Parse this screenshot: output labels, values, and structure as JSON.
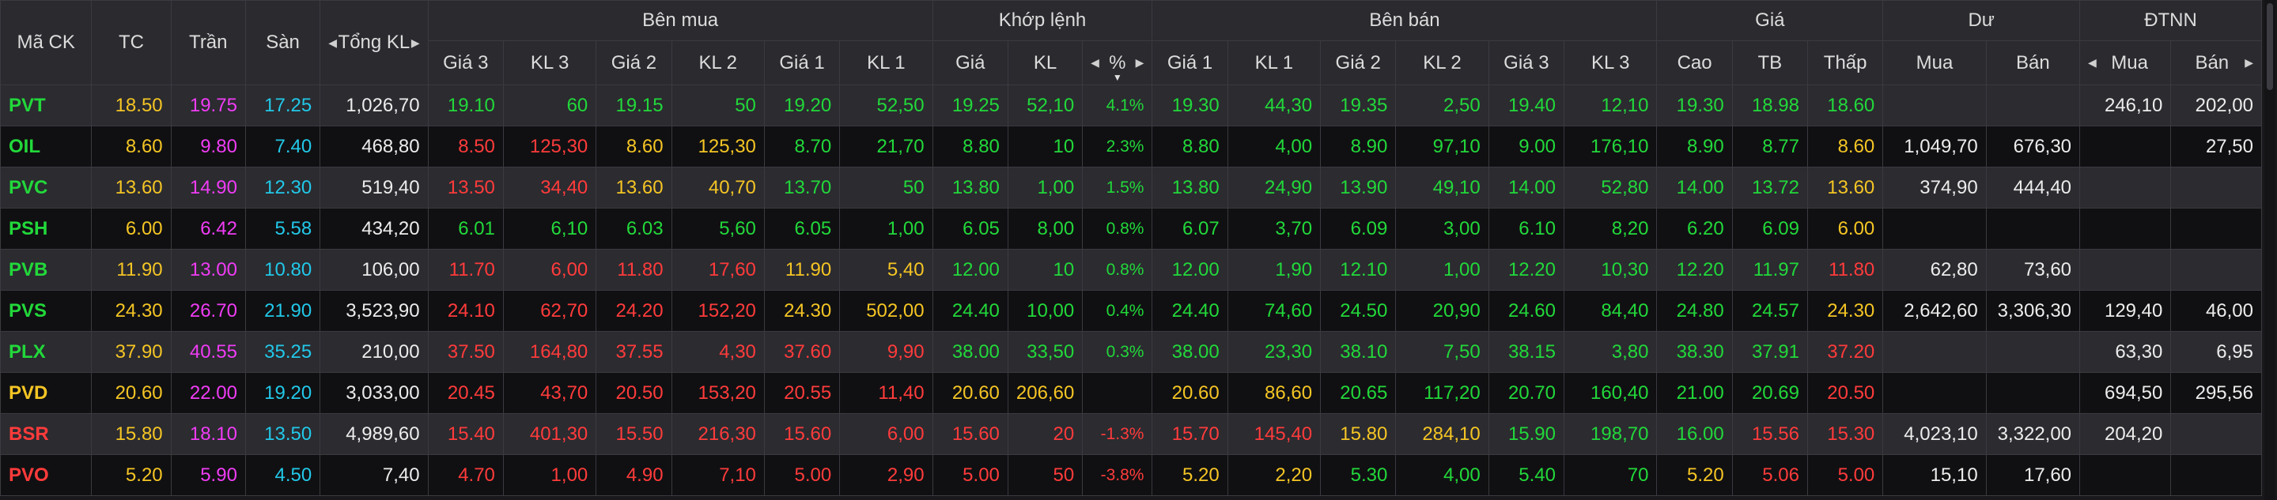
{
  "colors": {
    "up": "#22d83a",
    "down": "#ff3b3b",
    "ref": "#f5c524",
    "ceiling": "#f03cf5",
    "floor": "#22c8e8",
    "neutral": "#ececec"
  },
  "headers": {
    "ma_ck": "Mã CK",
    "tc": "TC",
    "tran": "Trần",
    "san": "Sàn",
    "tong_kl": "Tổng KL",
    "ben_mua": "Bên mua",
    "khop_lenh": "Khớp lệnh",
    "ben_ban": "Bên bán",
    "gia": "Giá",
    "du": "Dư",
    "dtnn": "ĐTNN",
    "gia3": "Giá 3",
    "kl3": "KL 3",
    "gia2": "Giá 2",
    "kl2": "KL 2",
    "gia1": "Giá 1",
    "kl1": "KL 1",
    "khop_gia": "Giá",
    "khop_kl": "KL",
    "khop_pct": "%",
    "cao": "Cao",
    "tb": "TB",
    "thap": "Thấp",
    "du_mua": "Mua",
    "du_ban": "Bán",
    "dtnn_mua": "Mua",
    "dtnn_ban": "Bán"
  },
  "icons": {
    "left": "◀",
    "right": "▶",
    "sort": "▼"
  },
  "rows": [
    {
      "sym": {
        "v": "PVT",
        "c": "up"
      },
      "tc": "18.50",
      "tran": "19.75",
      "san": "17.25",
      "tong": "1,026,70",
      "b3": {
        "v": "19.10",
        "c": "up"
      },
      "bk3": {
        "v": "60",
        "c": "up"
      },
      "b2": {
        "v": "19.15",
        "c": "up"
      },
      "bk2": {
        "v": "50",
        "c": "up"
      },
      "b1": {
        "v": "19.20",
        "c": "up"
      },
      "bk1": {
        "v": "52,50",
        "c": "up"
      },
      "mg": {
        "v": "19.25",
        "c": "up"
      },
      "mk": {
        "v": "52,10",
        "c": "up"
      },
      "mp": {
        "v": "4.1%",
        "c": "up"
      },
      "s1": {
        "v": "19.30",
        "c": "up"
      },
      "sk1": {
        "v": "44,30",
        "c": "up"
      },
      "s2": {
        "v": "19.35",
        "c": "up"
      },
      "sk2": {
        "v": "2,50",
        "c": "up"
      },
      "s3": {
        "v": "19.40",
        "c": "up"
      },
      "sk3": {
        "v": "12,10",
        "c": "up"
      },
      "cao": {
        "v": "19.30",
        "c": "up"
      },
      "tb": {
        "v": "18.98",
        "c": "up"
      },
      "thap": {
        "v": "18.60",
        "c": "up"
      },
      "dm": "",
      "db": "",
      "nm": "246,10",
      "nb": "202,00"
    },
    {
      "sym": {
        "v": "OIL",
        "c": "up"
      },
      "tc": "8.60",
      "tran": "9.80",
      "san": "7.40",
      "tong": "468,80",
      "b3": {
        "v": "8.50",
        "c": "down"
      },
      "bk3": {
        "v": "125,30",
        "c": "down"
      },
      "b2": {
        "v": "8.60",
        "c": "ref"
      },
      "bk2": {
        "v": "125,30",
        "c": "ref"
      },
      "b1": {
        "v": "8.70",
        "c": "up"
      },
      "bk1": {
        "v": "21,70",
        "c": "up"
      },
      "mg": {
        "v": "8.80",
        "c": "up"
      },
      "mk": {
        "v": "10",
        "c": "up"
      },
      "mp": {
        "v": "2.3%",
        "c": "up"
      },
      "s1": {
        "v": "8.80",
        "c": "up"
      },
      "sk1": {
        "v": "4,00",
        "c": "up"
      },
      "s2": {
        "v": "8.90",
        "c": "up"
      },
      "sk2": {
        "v": "97,10",
        "c": "up"
      },
      "s3": {
        "v": "9.00",
        "c": "up"
      },
      "sk3": {
        "v": "176,10",
        "c": "up"
      },
      "cao": {
        "v": "8.90",
        "c": "up"
      },
      "tb": {
        "v": "8.77",
        "c": "up"
      },
      "thap": {
        "v": "8.60",
        "c": "ref"
      },
      "dm": "1,049,70",
      "db": "676,30",
      "nm": "",
      "nb": "27,50"
    },
    {
      "sym": {
        "v": "PVC",
        "c": "up"
      },
      "tc": "13.60",
      "tran": "14.90",
      "san": "12.30",
      "tong": "519,40",
      "b3": {
        "v": "13.50",
        "c": "down"
      },
      "bk3": {
        "v": "34,40",
        "c": "down"
      },
      "b2": {
        "v": "13.60",
        "c": "ref"
      },
      "bk2": {
        "v": "40,70",
        "c": "ref"
      },
      "b1": {
        "v": "13.70",
        "c": "up"
      },
      "bk1": {
        "v": "50",
        "c": "up"
      },
      "mg": {
        "v": "13.80",
        "c": "up"
      },
      "mk": {
        "v": "1,00",
        "c": "up"
      },
      "mp": {
        "v": "1.5%",
        "c": "up"
      },
      "s1": {
        "v": "13.80",
        "c": "up"
      },
      "sk1": {
        "v": "24,90",
        "c": "up"
      },
      "s2": {
        "v": "13.90",
        "c": "up"
      },
      "sk2": {
        "v": "49,10",
        "c": "up"
      },
      "s3": {
        "v": "14.00",
        "c": "up"
      },
      "sk3": {
        "v": "52,80",
        "c": "up"
      },
      "cao": {
        "v": "14.00",
        "c": "up"
      },
      "tb": {
        "v": "13.72",
        "c": "up"
      },
      "thap": {
        "v": "13.60",
        "c": "ref"
      },
      "dm": "374,90",
      "db": "444,40",
      "nm": "",
      "nb": ""
    },
    {
      "sym": {
        "v": "PSH",
        "c": "up"
      },
      "tc": "6.00",
      "tran": "6.42",
      "san": "5.58",
      "tong": "434,20",
      "b3": {
        "v": "6.01",
        "c": "up"
      },
      "bk3": {
        "v": "6,10",
        "c": "up"
      },
      "b2": {
        "v": "6.03",
        "c": "up"
      },
      "bk2": {
        "v": "5,60",
        "c": "up"
      },
      "b1": {
        "v": "6.05",
        "c": "up"
      },
      "bk1": {
        "v": "1,00",
        "c": "up"
      },
      "mg": {
        "v": "6.05",
        "c": "up"
      },
      "mk": {
        "v": "8,00",
        "c": "up"
      },
      "mp": {
        "v": "0.8%",
        "c": "up"
      },
      "s1": {
        "v": "6.07",
        "c": "up"
      },
      "sk1": {
        "v": "3,70",
        "c": "up"
      },
      "s2": {
        "v": "6.09",
        "c": "up"
      },
      "sk2": {
        "v": "3,00",
        "c": "up"
      },
      "s3": {
        "v": "6.10",
        "c": "up"
      },
      "sk3": {
        "v": "8,20",
        "c": "up"
      },
      "cao": {
        "v": "6.20",
        "c": "up"
      },
      "tb": {
        "v": "6.09",
        "c": "up"
      },
      "thap": {
        "v": "6.00",
        "c": "ref"
      },
      "dm": "",
      "db": "",
      "nm": "",
      "nb": ""
    },
    {
      "sym": {
        "v": "PVB",
        "c": "up"
      },
      "tc": "11.90",
      "tran": "13.00",
      "san": "10.80",
      "tong": "106,00",
      "b3": {
        "v": "11.70",
        "c": "down"
      },
      "bk3": {
        "v": "6,00",
        "c": "down"
      },
      "b2": {
        "v": "11.80",
        "c": "down"
      },
      "bk2": {
        "v": "17,60",
        "c": "down"
      },
      "b1": {
        "v": "11.90",
        "c": "ref"
      },
      "bk1": {
        "v": "5,40",
        "c": "ref"
      },
      "mg": {
        "v": "12.00",
        "c": "up"
      },
      "mk": {
        "v": "10",
        "c": "up"
      },
      "mp": {
        "v": "0.8%",
        "c": "up"
      },
      "s1": {
        "v": "12.00",
        "c": "up"
      },
      "sk1": {
        "v": "1,90",
        "c": "up"
      },
      "s2": {
        "v": "12.10",
        "c": "up"
      },
      "sk2": {
        "v": "1,00",
        "c": "up"
      },
      "s3": {
        "v": "12.20",
        "c": "up"
      },
      "sk3": {
        "v": "10,30",
        "c": "up"
      },
      "cao": {
        "v": "12.20",
        "c": "up"
      },
      "tb": {
        "v": "11.97",
        "c": "up"
      },
      "thap": {
        "v": "11.80",
        "c": "down"
      },
      "dm": "62,80",
      "db": "73,60",
      "nm": "",
      "nb": ""
    },
    {
      "sym": {
        "v": "PVS",
        "c": "up"
      },
      "tc": "24.30",
      "tran": "26.70",
      "san": "21.90",
      "tong": "3,523,90",
      "b3": {
        "v": "24.10",
        "c": "down"
      },
      "bk3": {
        "v": "62,70",
        "c": "down"
      },
      "b2": {
        "v": "24.20",
        "c": "down"
      },
      "bk2": {
        "v": "152,20",
        "c": "down"
      },
      "b1": {
        "v": "24.30",
        "c": "ref"
      },
      "bk1": {
        "v": "502,00",
        "c": "ref"
      },
      "mg": {
        "v": "24.40",
        "c": "up"
      },
      "mk": {
        "v": "10,00",
        "c": "up"
      },
      "mp": {
        "v": "0.4%",
        "c": "up"
      },
      "s1": {
        "v": "24.40",
        "c": "up"
      },
      "sk1": {
        "v": "74,60",
        "c": "up"
      },
      "s2": {
        "v": "24.50",
        "c": "up"
      },
      "sk2": {
        "v": "20,90",
        "c": "up"
      },
      "s3": {
        "v": "24.60",
        "c": "up"
      },
      "sk3": {
        "v": "84,40",
        "c": "up"
      },
      "cao": {
        "v": "24.80",
        "c": "up"
      },
      "tb": {
        "v": "24.57",
        "c": "up"
      },
      "thap": {
        "v": "24.30",
        "c": "ref"
      },
      "dm": "2,642,60",
      "db": "3,306,30",
      "nm": "129,40",
      "nb": "46,00"
    },
    {
      "sym": {
        "v": "PLX",
        "c": "up"
      },
      "tc": "37.90",
      "tran": "40.55",
      "san": "35.25",
      "tong": "210,00",
      "b3": {
        "v": "37.50",
        "c": "down"
      },
      "bk3": {
        "v": "164,80",
        "c": "down"
      },
      "b2": {
        "v": "37.55",
        "c": "down"
      },
      "bk2": {
        "v": "4,30",
        "c": "down"
      },
      "b1": {
        "v": "37.60",
        "c": "down"
      },
      "bk1": {
        "v": "9,90",
        "c": "down"
      },
      "mg": {
        "v": "38.00",
        "c": "up"
      },
      "mk": {
        "v": "33,50",
        "c": "up"
      },
      "mp": {
        "v": "0.3%",
        "c": "up"
      },
      "s1": {
        "v": "38.00",
        "c": "up"
      },
      "sk1": {
        "v": "23,30",
        "c": "up"
      },
      "s2": {
        "v": "38.10",
        "c": "up"
      },
      "sk2": {
        "v": "7,50",
        "c": "up"
      },
      "s3": {
        "v": "38.15",
        "c": "up"
      },
      "sk3": {
        "v": "3,80",
        "c": "up"
      },
      "cao": {
        "v": "38.30",
        "c": "up"
      },
      "tb": {
        "v": "37.91",
        "c": "up"
      },
      "thap": {
        "v": "37.20",
        "c": "down"
      },
      "dm": "",
      "db": "",
      "nm": "63,30",
      "nb": "6,95"
    },
    {
      "sym": {
        "v": "PVD",
        "c": "ref"
      },
      "tc": "20.60",
      "tran": "22.00",
      "san": "19.20",
      "tong": "3,033,00",
      "b3": {
        "v": "20.45",
        "c": "down"
      },
      "bk3": {
        "v": "43,70",
        "c": "down"
      },
      "b2": {
        "v": "20.50",
        "c": "down"
      },
      "bk2": {
        "v": "153,20",
        "c": "down"
      },
      "b1": {
        "v": "20.55",
        "c": "down"
      },
      "bk1": {
        "v": "11,40",
        "c": "down"
      },
      "mg": {
        "v": "20.60",
        "c": "ref"
      },
      "mk": {
        "v": "206,60",
        "c": "ref"
      },
      "mp": {
        "v": "",
        "c": "ref"
      },
      "s1": {
        "v": "20.60",
        "c": "ref"
      },
      "sk1": {
        "v": "86,60",
        "c": "ref"
      },
      "s2": {
        "v": "20.65",
        "c": "up"
      },
      "sk2": {
        "v": "117,20",
        "c": "up"
      },
      "s3": {
        "v": "20.70",
        "c": "up"
      },
      "sk3": {
        "v": "160,40",
        "c": "up"
      },
      "cao": {
        "v": "21.00",
        "c": "up"
      },
      "tb": {
        "v": "20.69",
        "c": "up"
      },
      "thap": {
        "v": "20.50",
        "c": "down"
      },
      "dm": "",
      "db": "",
      "nm": "694,50",
      "nb": "295,56"
    },
    {
      "sym": {
        "v": "BSR",
        "c": "down"
      },
      "tc": "15.80",
      "tran": "18.10",
      "san": "13.50",
      "tong": "4,989,60",
      "b3": {
        "v": "15.40",
        "c": "down"
      },
      "bk3": {
        "v": "401,30",
        "c": "down"
      },
      "b2": {
        "v": "15.50",
        "c": "down"
      },
      "bk2": {
        "v": "216,30",
        "c": "down"
      },
      "b1": {
        "v": "15.60",
        "c": "down"
      },
      "bk1": {
        "v": "6,00",
        "c": "down"
      },
      "mg": {
        "v": "15.60",
        "c": "down"
      },
      "mk": {
        "v": "20",
        "c": "down"
      },
      "mp": {
        "v": "-1.3%",
        "c": "down"
      },
      "s1": {
        "v": "15.70",
        "c": "down"
      },
      "sk1": {
        "v": "145,40",
        "c": "down"
      },
      "s2": {
        "v": "15.80",
        "c": "ref"
      },
      "sk2": {
        "v": "284,10",
        "c": "ref"
      },
      "s3": {
        "v": "15.90",
        "c": "up"
      },
      "sk3": {
        "v": "198,70",
        "c": "up"
      },
      "cao": {
        "v": "16.00",
        "c": "up"
      },
      "tb": {
        "v": "15.56",
        "c": "down"
      },
      "thap": {
        "v": "15.30",
        "c": "down"
      },
      "dm": "4,023,10",
      "db": "3,322,00",
      "nm": "204,20",
      "nb": ""
    },
    {
      "sym": {
        "v": "PVO",
        "c": "down"
      },
      "tc": "5.20",
      "tran": "5.90",
      "san": "4.50",
      "tong": "7,40",
      "b3": {
        "v": "4.70",
        "c": "down"
      },
      "bk3": {
        "v": "1,00",
        "c": "down"
      },
      "b2": {
        "v": "4.90",
        "c": "down"
      },
      "bk2": {
        "v": "7,10",
        "c": "down"
      },
      "b1": {
        "v": "5.00",
        "c": "down"
      },
      "bk1": {
        "v": "2,90",
        "c": "down"
      },
      "mg": {
        "v": "5.00",
        "c": "down"
      },
      "mk": {
        "v": "50",
        "c": "down"
      },
      "mp": {
        "v": "-3.8%",
        "c": "down"
      },
      "s1": {
        "v": "5.20",
        "c": "ref"
      },
      "sk1": {
        "v": "2,20",
        "c": "ref"
      },
      "s2": {
        "v": "5.30",
        "c": "up"
      },
      "sk2": {
        "v": "4,00",
        "c": "up"
      },
      "s3": {
        "v": "5.40",
        "c": "up"
      },
      "sk3": {
        "v": "70",
        "c": "up"
      },
      "cao": {
        "v": "5.20",
        "c": "ref"
      },
      "tb": {
        "v": "5.06",
        "c": "down"
      },
      "thap": {
        "v": "5.00",
        "c": "down"
      },
      "dm": "15,10",
      "db": "17,60",
      "nm": "",
      "nb": ""
    }
  ]
}
